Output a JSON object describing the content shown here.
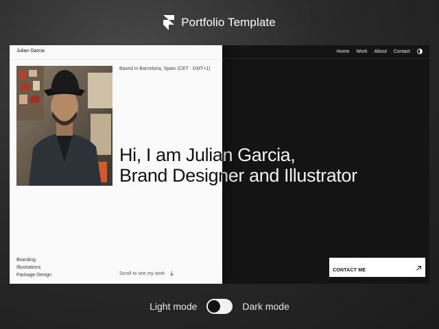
{
  "header": {
    "title": "Portfolio Template",
    "logo_icon": "framer-logo-icon"
  },
  "site": {
    "name": "Julian Garcia",
    "nav": [
      "Home",
      "Work",
      "About",
      "Contact"
    ],
    "theme_icon": "half-circle-icon",
    "location": "Based in Barcelona, Spain (CET · GMT+1)",
    "headline": [
      "Hi, I am Julian Garcia,",
      "Brand Designer and Illustrator"
    ],
    "services": [
      "Branding",
      "Illustrations",
      "Package Design"
    ],
    "scroll_text": "Scroll to see my work",
    "scroll_icon": "arrow-down-icon",
    "contact_label": "CONTACT ME",
    "contact_icon": "arrow-up-right-icon"
  },
  "toggle": {
    "light_label": "Light mode",
    "dark_label": "Dark mode",
    "state": "dark"
  },
  "colors": {
    "light_bg": "#fafafa",
    "dark_bg": "#141414",
    "page_bg": "#2a2a2a",
    "accent": "#ffffff"
  }
}
